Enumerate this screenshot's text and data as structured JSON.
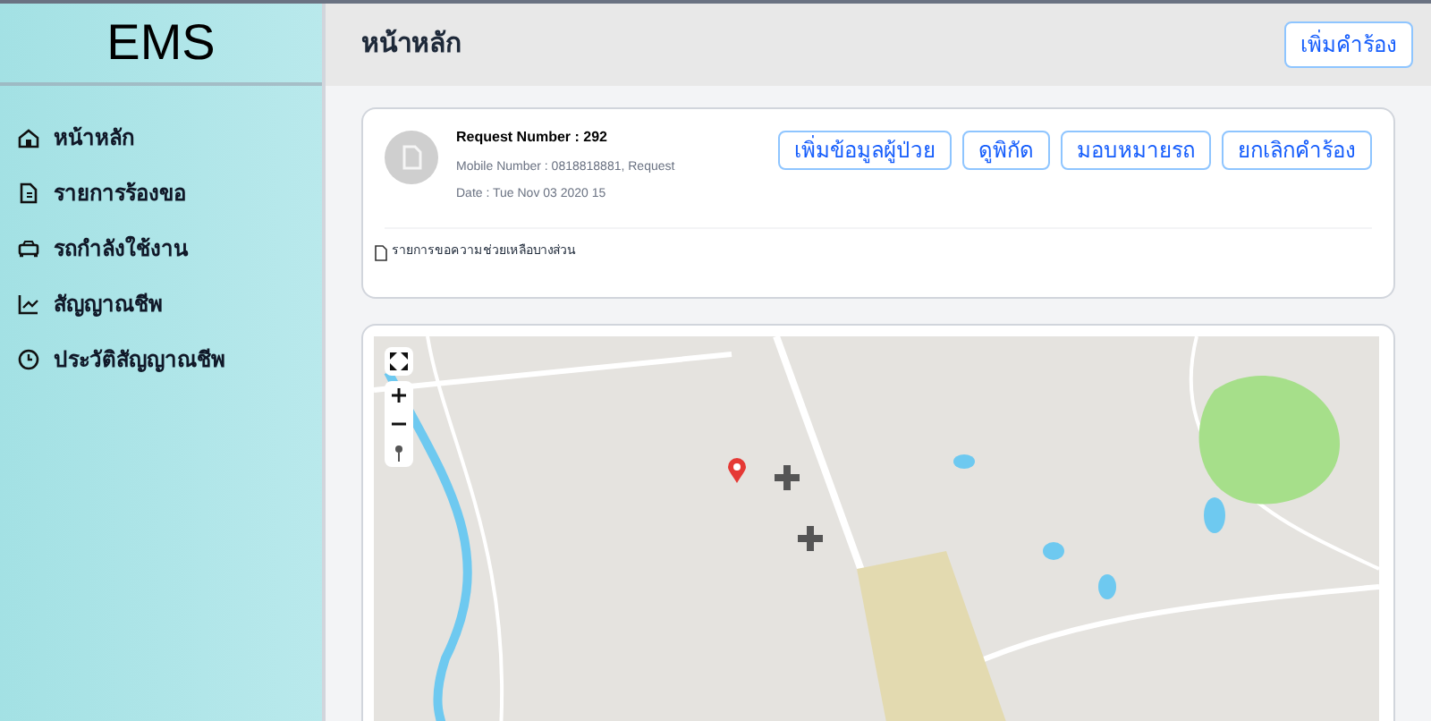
{
  "sidebar": {
    "brand": "EMS",
    "items": [
      {
        "label": "หน้าหลัก"
      },
      {
        "label": "รายการร้องขอ"
      },
      {
        "label": "รถกำลังใช้งาน"
      },
      {
        "label": "สัญญาณชีพ"
      },
      {
        "label": "ประวัติสัญญาณชีพ"
      }
    ]
  },
  "header": {
    "title": "หน้าหลัก",
    "button": "เพิ่มคำร้อง"
  },
  "request": {
    "title": "Request Number : 292",
    "details": [
      "Mobile Number : 0818818881, Request",
      "Date : Tue Nov 03 2020 15"
    ],
    "buttons": [
      "เพิ่มข้อมูลผู้ป่วย",
      "ดูพิกัด",
      "มอบหมายรถ",
      "ยกเลิกคำร้อง"
    ],
    "footer_link": "รายการขอความช่วยเหลือบางส่วน"
  }
}
